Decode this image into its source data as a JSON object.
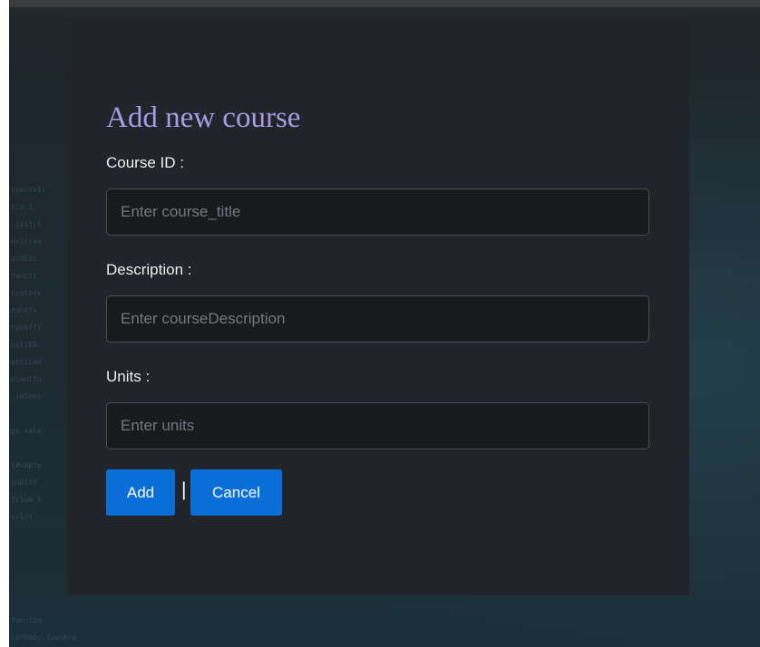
{
  "modal": {
    "title": "Add new course",
    "fields": [
      {
        "label": "Course ID :",
        "placeholder": "Enter course_title",
        "value": ""
      },
      {
        "label": "Description :",
        "placeholder": "Enter courseDescription",
        "value": ""
      },
      {
        "label": "Units :",
        "placeholder": "Enter units",
        "value": ""
      }
    ],
    "buttons": {
      "add_label": "Add",
      "separator": "|",
      "cancel_label": "Cancel"
    }
  },
  "colors": {
    "title": "#a99ae6",
    "primary_button": "#0a6fd8",
    "modal_background": "#212529",
    "input_background": "#181b1e"
  }
}
